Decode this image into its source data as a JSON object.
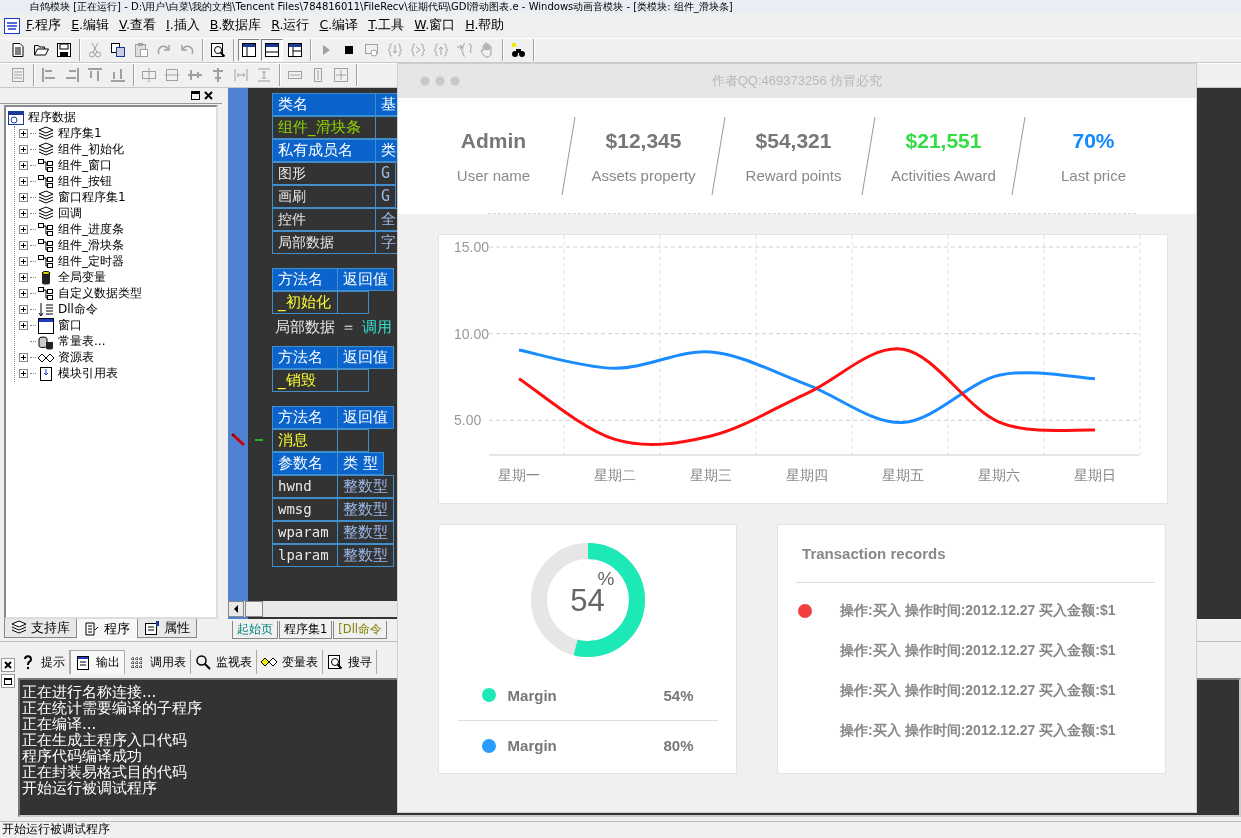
{
  "window": {
    "title": "白鸽模块 [正在运行] - D:\\用户\\白菜\\我的文档\\Tencent Files\\784816011\\FileRecv\\征期代码\\GDI滑动图表.e - Windows动画音模块 - [类模块: 组件_滑块条]"
  },
  "menu": [
    "F.程序",
    "E.编辑",
    "V.查看",
    "I.插入",
    "B.数据库",
    "R.运行",
    "C.编译",
    "T.工具",
    "W.窗口",
    "H.帮助"
  ],
  "toolbars": [
    [
      [
        {
          "kind": "new",
          "disabled": false,
          "pressed": false
        },
        {
          "kind": "open",
          "disabled": false,
          "pressed": false
        },
        {
          "kind": "save",
          "disabled": false,
          "pressed": false
        }
      ],
      [
        {
          "kind": "cut",
          "disabled": true,
          "pressed": false
        },
        {
          "kind": "copy",
          "disabled": false,
          "pressed": false
        },
        {
          "kind": "paste",
          "disabled": true,
          "pressed": false
        },
        {
          "kind": "redo",
          "disabled": true,
          "pressed": false
        },
        {
          "kind": "undo",
          "disabled": true,
          "pressed": false
        }
      ],
      [
        {
          "kind": "find",
          "disabled": false,
          "pressed": false
        }
      ],
      [
        {
          "kind": "layout1",
          "disabled": false,
          "pressed": true
        },
        {
          "kind": "layout2",
          "disabled": false,
          "pressed": true
        },
        {
          "kind": "layout3",
          "disabled": false,
          "pressed": false
        }
      ],
      [
        {
          "kind": "run",
          "disabled": true,
          "pressed": false
        },
        {
          "kind": "stop",
          "disabled": false,
          "pressed": false
        },
        {
          "kind": "compile",
          "disabled": true,
          "pressed": false
        },
        {
          "kind": "step1",
          "disabled": true,
          "pressed": false
        },
        {
          "kind": "step2",
          "disabled": true,
          "pressed": false
        },
        {
          "kind": "step3",
          "disabled": true,
          "pressed": false
        },
        {
          "kind": "step4",
          "disabled": true,
          "pressed": false
        },
        {
          "kind": "hand",
          "disabled": true,
          "pressed": false
        }
      ],
      [
        {
          "kind": "helpfind",
          "disabled": false,
          "pressed": false
        }
      ]
    ],
    [
      [
        {
          "kind": "form",
          "disabled": true,
          "pressed": false
        }
      ],
      [
        {
          "kind": "al",
          "disabled": true,
          "pressed": false
        },
        {
          "kind": "ar",
          "disabled": true,
          "pressed": false
        },
        {
          "kind": "at",
          "disabled": true,
          "pressed": false
        },
        {
          "kind": "ab",
          "disabled": true,
          "pressed": false
        }
      ],
      [
        {
          "kind": "ch",
          "disabled": true,
          "pressed": false
        },
        {
          "kind": "cv",
          "disabled": true,
          "pressed": false
        },
        {
          "kind": "am",
          "disabled": true,
          "pressed": false
        },
        {
          "kind": "ac",
          "disabled": true,
          "pressed": false
        },
        {
          "kind": "sh",
          "disabled": true,
          "pressed": false
        },
        {
          "kind": "sv",
          "disabled": true,
          "pressed": false
        }
      ],
      [
        {
          "kind": "sw",
          "disabled": true,
          "pressed": false
        },
        {
          "kind": "shh",
          "disabled": true,
          "pressed": false
        },
        {
          "kind": "ss",
          "disabled": true,
          "pressed": false
        }
      ]
    ]
  ],
  "tree": {
    "label": "程序数据",
    "kind": "root",
    "expanded": true,
    "children": [
      {
        "label": "程序集1",
        "kind": "set",
        "has_children": true,
        "expanded": false
      },
      {
        "label": "组件_初始化",
        "kind": "set",
        "has_children": true,
        "expanded": false
      },
      {
        "label": "组件_窗口",
        "kind": "class",
        "has_children": true,
        "expanded": false
      },
      {
        "label": "组件_按钮",
        "kind": "class",
        "has_children": true,
        "expanded": false
      },
      {
        "label": "窗口程序集1",
        "kind": "set",
        "has_children": true,
        "expanded": false
      },
      {
        "label": "回调",
        "kind": "set",
        "has_children": true,
        "expanded": false
      },
      {
        "label": "组件_进度条",
        "kind": "class",
        "has_children": true,
        "expanded": false
      },
      {
        "label": "组件_滑块条",
        "kind": "class",
        "has_children": true,
        "expanded": false
      },
      {
        "label": "组件_定时器",
        "kind": "class",
        "has_children": true,
        "expanded": false
      },
      {
        "label": "全局变量",
        "kind": "globals",
        "has_children": true,
        "expanded": false
      },
      {
        "label": "自定义数据类型",
        "kind": "class",
        "has_children": true,
        "expanded": false
      },
      {
        "label": "Dll命令",
        "kind": "dll",
        "has_children": true,
        "expanded": false
      },
      {
        "label": "窗口",
        "kind": "window",
        "has_children": true,
        "expanded": false
      },
      {
        "label": "常量表...",
        "kind": "constants",
        "has_children": false
      },
      {
        "label": "资源表",
        "kind": "resources",
        "has_children": true,
        "expanded": false
      },
      {
        "label": "模块引用表",
        "kind": "modules",
        "has_children": true,
        "expanded": false
      }
    ]
  },
  "left_tabs": [
    {
      "label": "支持库",
      "kind": "library",
      "selected": false
    },
    {
      "label": "程序",
      "kind": "program",
      "selected": true
    },
    {
      "label": "属性",
      "kind": "properties",
      "selected": false
    }
  ],
  "code": [
    {
      "kind": "table",
      "rows": [
        {
          "kind": "header",
          "cells": [
            "类名",
            "基"
          ],
          "current": false
        },
        {
          "kind": "class_title",
          "cells": [
            "组件_滑块条",
            ""
          ],
          "current": false
        },
        {
          "kind": "header",
          "cells": [
            "私有成员名",
            "类"
          ],
          "current": false
        },
        {
          "kind": "data",
          "cells": [
            "图形",
            "G"
          ],
          "current": false
        },
        {
          "kind": "data",
          "cells": [
            "画刷",
            "G"
          ],
          "current": false
        },
        {
          "kind": "data",
          "cells": [
            "控件",
            "全"
          ],
          "current": false
        },
        {
          "kind": "data",
          "cells": [
            "局部数据",
            "字"
          ],
          "current": false
        }
      ]
    },
    {
      "kind": "table",
      "rows": [
        {
          "kind": "header",
          "cells": [
            "方法名",
            "返回值"
          ],
          "current": false
        },
        {
          "kind": "method_title",
          "cells": [
            "_初始化",
            ""
          ],
          "current": false
        }
      ]
    },
    {
      "kind": "statement",
      "parts": [
        {
          "kind": "name",
          "text": "局部数据"
        },
        {
          "kind": "operator",
          "text": "＝"
        },
        {
          "kind": "call",
          "text": "调用"
        }
      ]
    },
    {
      "kind": "table",
      "rows": [
        {
          "kind": "header",
          "cells": [
            "方法名",
            "返回值"
          ],
          "current": false
        },
        {
          "kind": "method_title",
          "cells": [
            "_销毁",
            ""
          ],
          "current": false
        }
      ]
    },
    {
      "kind": "table",
      "rows": [
        {
          "kind": "header",
          "cells": [
            "方法名",
            "返回值"
          ],
          "current": false
        },
        {
          "kind": "method_title",
          "cells": [
            "消息",
            ""
          ],
          "current": true
        },
        {
          "kind": "header",
          "cells": [
            "参数名",
            "类 型"
          ],
          "current": false
        },
        {
          "kind": "data",
          "cells": [
            "hwnd",
            "整数型"
          ],
          "current": false
        },
        {
          "kind": "data",
          "cells": [
            "wmsg",
            "整数型"
          ],
          "current": false
        },
        {
          "kind": "data",
          "cells": [
            "wparam",
            "整数型"
          ],
          "current": false
        },
        {
          "kind": "data",
          "cells": [
            "lparam",
            "整数型"
          ],
          "current": false
        }
      ]
    }
  ],
  "editor_tabs": [
    {
      "label": "起始页",
      "kind": "start",
      "selected": false
    },
    {
      "label": "程序集1",
      "kind": "module",
      "selected": false
    },
    {
      "label": "[Dll命令",
      "kind": "dll",
      "selected": false
    }
  ],
  "output_tabs": [
    {
      "label": "提示",
      "kind": "hint",
      "selected": false
    },
    {
      "label": "输出",
      "kind": "output",
      "selected": true
    },
    {
      "label": "调用表",
      "kind": "calls",
      "selected": false
    },
    {
      "label": "监视表",
      "kind": "watch",
      "selected": false
    },
    {
      "label": "变量表",
      "kind": "vars",
      "selected": false
    },
    {
      "label": "搜寻",
      "kind": "search",
      "selected": false
    }
  ],
  "output_lines": [
    "正在进行名称连接...",
    "正在统计需要编译的子程序",
    "正在编译...",
    "正在生成主程序入口代码",
    "程序代码编译成功",
    "正在封装易格式目的代码",
    "开始运行被调试程序"
  ],
  "status_bar": "开始运行被调试程序",
  "dashboard": {
    "title": "作者QQ:469373256 仿冒必究",
    "stats": [
      {
        "value": "Admin",
        "label": "User name",
        "color": "#777777"
      },
      {
        "value": "$12,345",
        "label": "Assets property",
        "color": "#777777"
      },
      {
        "value": "$54,321",
        "label": "Reward points",
        "color": "#777777"
      },
      {
        "value": "$21,551",
        "label": "Activities Award",
        "color": "#33dd44"
      },
      {
        "value": "70%",
        "label": "Last price",
        "color": "#1188ff"
      }
    ],
    "chart_data": {
      "type": "line",
      "categories": [
        "星期一",
        "星期二",
        "星期三",
        "星期四",
        "星期五",
        "星期六",
        "星期日"
      ],
      "series": [
        {
          "color": "#1a8cff",
          "values": [
            9.06,
            8.0,
            8.94,
            7.06,
            4.88,
            7.6,
            7.4
          ]
        },
        {
          "color": "#ff1010",
          "values": [
            7.4,
            3.9,
            4.1,
            6.56,
            9.1,
            4.9,
            4.44
          ]
        }
      ],
      "ylim": [
        3,
        15
      ],
      "grid": true,
      "yticks": [
        {
          "value": 5,
          "label": "5.00"
        },
        {
          "value": 10,
          "label": "10.00"
        },
        {
          "value": 15,
          "label": "15.00"
        }
      ],
      "xlabel": null
    },
    "donut": {
      "value": "54",
      "unit": "%",
      "level": 0.54,
      "color": "#1de9b6",
      "legend": [
        {
          "label": "Margin",
          "value": "54%",
          "color": "#1de9b6"
        },
        {
          "label": "Margin",
          "value": "80%",
          "color": "#2a9dff"
        }
      ]
    },
    "transactions": {
      "title": "Transaction records",
      "rows": [
        {
          "text": "操作:买入 操作时间:2012.12.27 买入金额:$1",
          "dot": true
        },
        {
          "text": "操作:买入 操作时间:2012.12.27 买入金额:$1",
          "dot": false
        },
        {
          "text": "操作:买入 操作时间:2012.12.27 买入金额:$1",
          "dot": false
        },
        {
          "text": "操作:买入 操作时间:2012.12.27 买入金额:$1",
          "dot": false
        }
      ]
    }
  }
}
